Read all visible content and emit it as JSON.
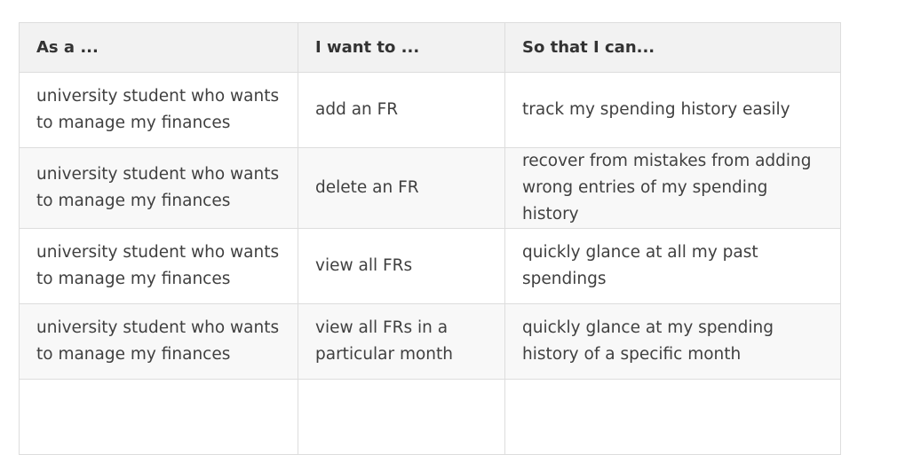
{
  "table": {
    "headers": [
      "As a ...",
      "I want to ...",
      "So that I can..."
    ],
    "rows": [
      [
        "university student who wants to manage my finances",
        "add an FR",
        "track my spending history easily"
      ],
      [
        "university student who wants to manage my finances",
        "delete an FR",
        "recover from mistakes from adding wrong entries of my spending history"
      ],
      [
        "university student who wants to manage my finances",
        "view all FRs",
        "quickly glance at all my past spendings"
      ],
      [
        "university student who wants to manage my finances",
        "view all FRs in a particular month",
        "quickly glance at my spending history of a specific month"
      ],
      [
        "",
        "",
        ""
      ]
    ]
  }
}
